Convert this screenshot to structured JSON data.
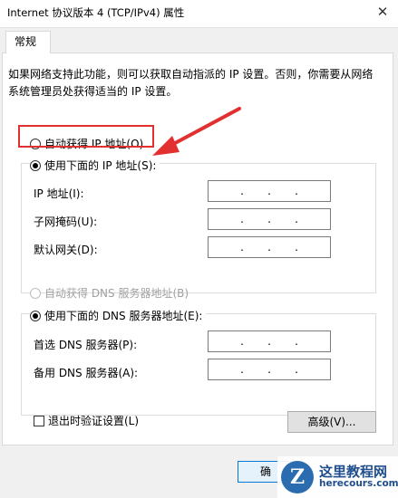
{
  "window": {
    "title": "Internet 协议版本 4 (TCP/IPv4) 属性",
    "close_glyph": "✕"
  },
  "tabs": [
    {
      "label": "常规"
    }
  ],
  "description": "如果网络支持此功能，则可以获取自动指派的 IP 设置。否则，你需要从网络系统管理员处获得适当的 IP 设置。",
  "ip_section": {
    "auto_option": {
      "label": "自动获得 IP 地址(O)",
      "selected": false
    },
    "manual_option": {
      "label": "使用下面的 IP 地址(S):",
      "selected": true
    },
    "fields": [
      {
        "label": "IP 地址(I):",
        "value": ".     .     ."
      },
      {
        "label": "子网掩码(U):",
        "value": ".     .     ."
      },
      {
        "label": "默认网关(D):",
        "value": ".     .     ."
      }
    ]
  },
  "dns_section": {
    "auto_option": {
      "label": "自动获得 DNS 服务器地址(B)",
      "selected": false,
      "disabled": true
    },
    "manual_option": {
      "label": "使用下面的 DNS 服务器地址(E):",
      "selected": true
    },
    "fields": [
      {
        "label": "首选 DNS 服务器(P):",
        "value": ".     .     ."
      },
      {
        "label": "备用 DNS 服务器(A):",
        "value": ".     .     ."
      }
    ]
  },
  "validate_checkbox": {
    "label": "退出时验证设置(L)",
    "checked": false
  },
  "advanced_button": {
    "label": "高级(V)..."
  },
  "ok_button": {
    "label": "确"
  },
  "annotation": {
    "color": "#e23030"
  },
  "watermark": {
    "logo_letter": "Z",
    "name": "这里教程网",
    "url": "herecours.com"
  }
}
